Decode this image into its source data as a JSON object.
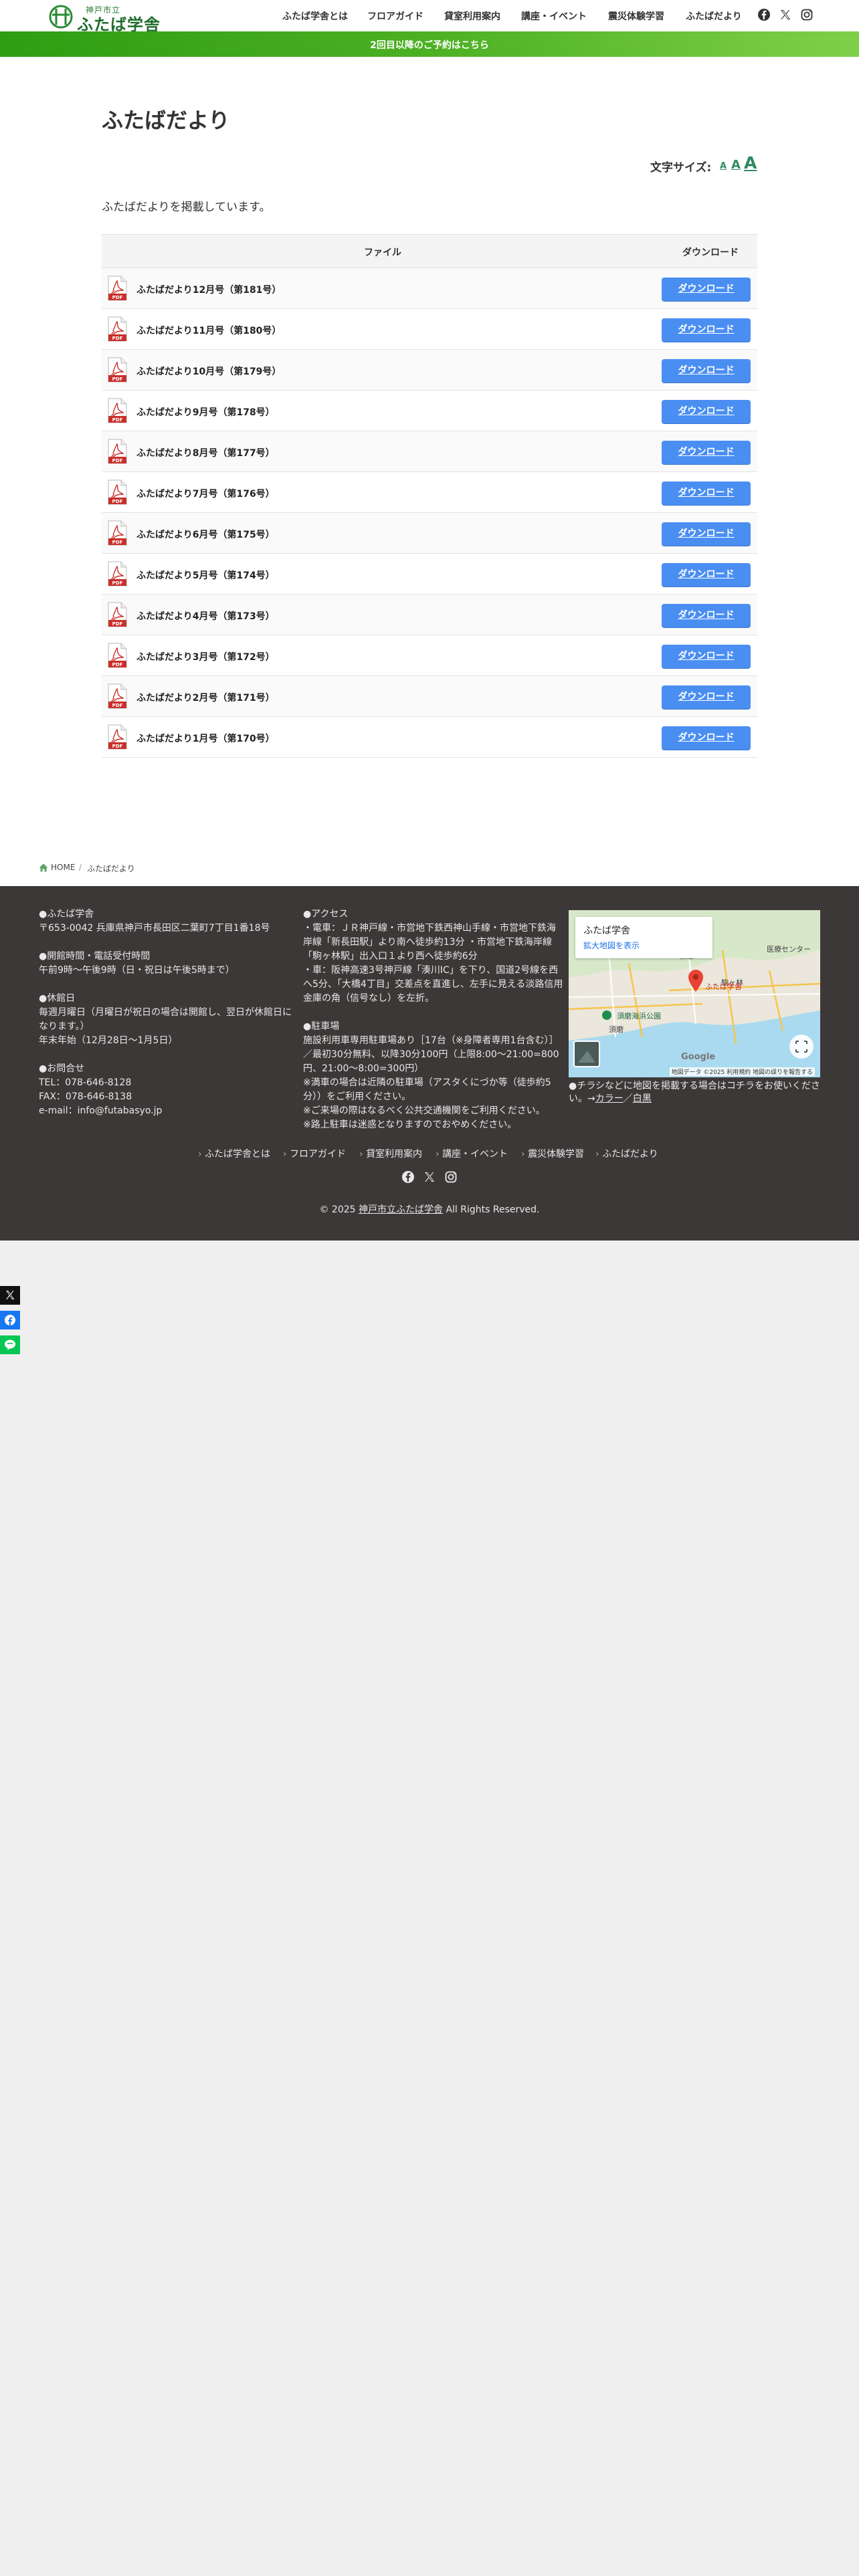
{
  "header": {
    "logo_small": "神戸市立",
    "logo_big": "ふたば学舎",
    "nav": [
      "ふたば学舎とは",
      "フロアガイド",
      "貸室利用案内",
      "講座・イベント",
      "震災体験学習",
      "ふたばだより"
    ],
    "social_icons": [
      "facebook-icon",
      "x-icon",
      "instagram-icon"
    ]
  },
  "banner": {
    "text": "2回目以降のご予約はこちら"
  },
  "main": {
    "title": "ふたばだより",
    "fontsize_label": "文字サイズ:",
    "fontsize_options": [
      "A",
      "A",
      "A"
    ],
    "intro": "ふたばだよりを掲載しています。",
    "table": {
      "header_file": "ファイル",
      "header_download": "ダウンロード",
      "rows": [
        {
          "label": "ふたばだより12月号（第181号）",
          "button": "ダウンロード"
        },
        {
          "label": "ふたばだより11月号（第180号）",
          "button": "ダウンロード"
        },
        {
          "label": "ふたばだより10月号（第179号）",
          "button": "ダウンロード"
        },
        {
          "label": "ふたばだより9月号（第178号）",
          "button": "ダウンロード"
        },
        {
          "label": "ふたばだより8月号（第177号）",
          "button": "ダウンロード"
        },
        {
          "label": "ふたばだより7月号（第176号）",
          "button": "ダウンロード"
        },
        {
          "label": "ふたばだより6月号（第175号）",
          "button": "ダウンロード"
        },
        {
          "label": "ふたばだより5月号（第174号）",
          "button": "ダウンロード"
        },
        {
          "label": "ふたばだより4月号（第173号）",
          "button": "ダウンロード"
        },
        {
          "label": "ふたばだより3月号（第172号）",
          "button": "ダウンロード"
        },
        {
          "label": "ふたばだより2月号（第171号）",
          "button": "ダウンロード"
        },
        {
          "label": "ふたばだより1月号（第170号）",
          "button": "ダウンロード"
        }
      ],
      "pdf_icon_text": "PDF"
    }
  },
  "breadcrumb": {
    "home": "HOME",
    "separator": "/",
    "current": "ふたばだより"
  },
  "footer": {
    "col1": [
      "●ふたば学舎",
      "〒653-0042 兵庫県神戸市長田区二葉町7丁目1番18号",
      "",
      "●開館時間・電話受付時間",
      "午前9時〜午後9時（日・祝日は午後5時まで）",
      "",
      "●休館日",
      "毎週月曜日（月曜日が祝日の場合は開館し、翌日が休館日に",
      "なります。）",
      "年末年始（12月28日〜1月5日）",
      "",
      "●お問合せ",
      "TEL：078-646-8128",
      "FAX：078-646-8138",
      "e-mail：info@futabasyo.jp"
    ],
    "col2": [
      "●アクセス",
      "・電車：ＪＲ神戸線・市営地下鉄西神山手線・市営地下鉄海",
      "岸線「新長田駅」より南へ徒歩約13分 ・市営地下鉄海岸線",
      "「駒ヶ林駅」出入口１より西へ徒歩約6分",
      "・車：阪神高速3号神戸線「湊川IC」を下り、国道2号線を西",
      "へ5分、「大橋4丁目」交差点を直進し、左手に見える淡路信用",
      "金庫の角（信号なし）を左折。",
      "",
      "●駐車場",
      "施設利用車専用駐車場あり［17台（※身障者専用1台含む）］",
      "／最初30分無料、以降30分100円（上限8:00〜21:00=800",
      "円、21:00〜8:00=300円）",
      "※満車の場合は近隣の駐車場（アスタくにづか等（徒歩約5",
      "分））をご利用ください。",
      "※ご来場の際はなるべく公共交通機関をご利用ください。",
      "※路上駐車は迷惑となりますのでおやめください。"
    ],
    "map": {
      "place_name": "ふたば学舎",
      "map_link": "拡大地図を表示",
      "pin_label": "ふたば学舎",
      "labels": [
        "板宿",
        "須磨海浜公園",
        "須磨",
        "医療センター",
        "駒ヶ林"
      ],
      "footer_text": "地図データ ©2025  利用規約  地図の誤りを報告する",
      "google": "Google"
    },
    "map_note_prefix": "●チラシなどに地図を掲載する場合はコチラをお使いくださ",
    "map_note_line2": "い。→",
    "map_note_color": "カラー",
    "map_note_sep": "／",
    "map_note_mono": "白黒",
    "nav": [
      "ふたば学舎とは",
      "フロアガイド",
      "貸室利用案内",
      "講座・イベント",
      "震災体験学習",
      "ふたばだより"
    ],
    "social_icons": [
      "facebook-icon",
      "x-icon",
      "instagram-icon"
    ],
    "copyright_prefix": "© 2025 ",
    "copyright_link": "神戸市立ふたば学舎",
    "copyright_suffix": " All Rights Reserved."
  },
  "share": [
    "x-share-icon",
    "facebook-share-icon",
    "line-share-icon"
  ],
  "colors": {
    "green": "#3ba81a",
    "button_blue": "#4a8ef2",
    "footer_bg": "#3d3838",
    "fontsize_link": "#2f8a5f"
  }
}
